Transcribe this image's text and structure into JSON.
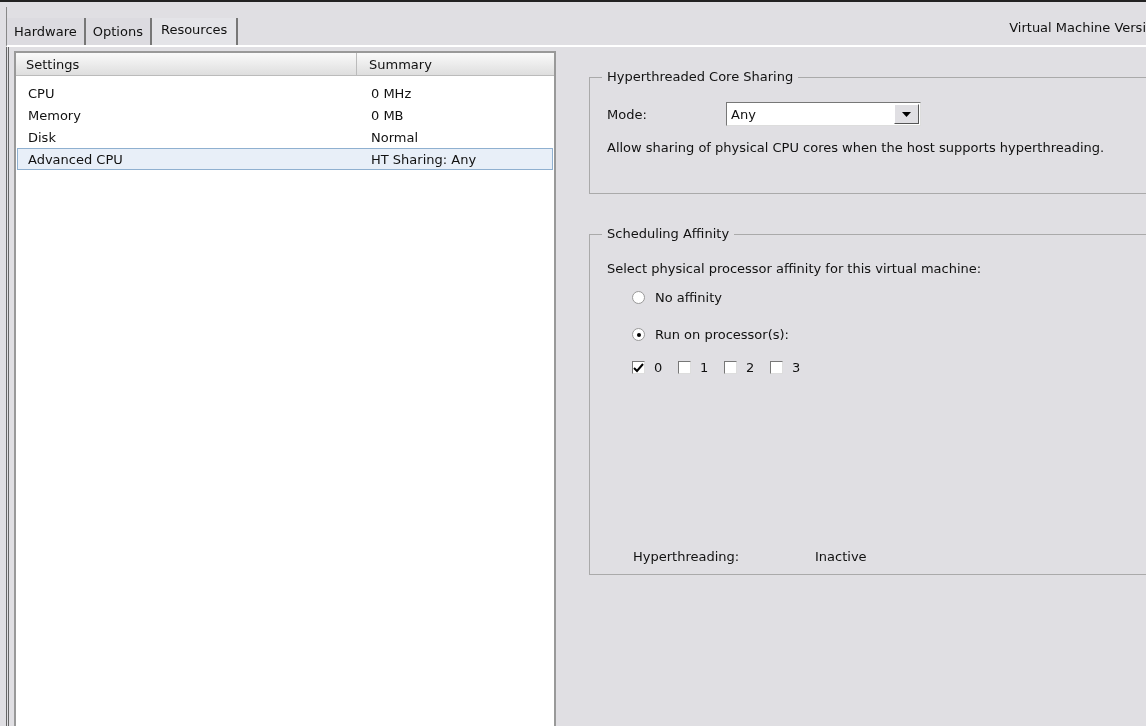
{
  "tabs": [
    {
      "label": "Hardware",
      "selected": false
    },
    {
      "label": "Options",
      "selected": false
    },
    {
      "label": "Resources",
      "selected": true
    }
  ],
  "version_label": "Virtual Machine Versi",
  "settings_table": {
    "columns": [
      "Settings",
      "Summary"
    ],
    "rows": [
      {
        "setting": "CPU",
        "summary": "0 MHz",
        "selected": false
      },
      {
        "setting": "Memory",
        "summary": "0 MB",
        "selected": false
      },
      {
        "setting": "Disk",
        "summary": "Normal",
        "selected": false
      },
      {
        "setting": "Advanced CPU",
        "summary": "HT Sharing: Any",
        "selected": true
      }
    ]
  },
  "hyperthreaded_core_sharing": {
    "title": "Hyperthreaded Core Sharing",
    "mode_label": "Mode:",
    "mode_value": "Any",
    "description": "Allow sharing of physical CPU cores when the host supports hyperthreading."
  },
  "scheduling_affinity": {
    "title": "Scheduling Affinity",
    "prompt": "Select physical processor affinity for this virtual machine:",
    "options": [
      {
        "label": "No affinity",
        "selected": false
      },
      {
        "label": "Run on processor(s):",
        "selected": true
      }
    ],
    "processors": [
      {
        "label": "0",
        "checked": true
      },
      {
        "label": "1",
        "checked": false
      },
      {
        "label": "2",
        "checked": false
      },
      {
        "label": "3",
        "checked": false
      }
    ],
    "status_label": "Hyperthreading:",
    "status_value": "Inactive"
  }
}
